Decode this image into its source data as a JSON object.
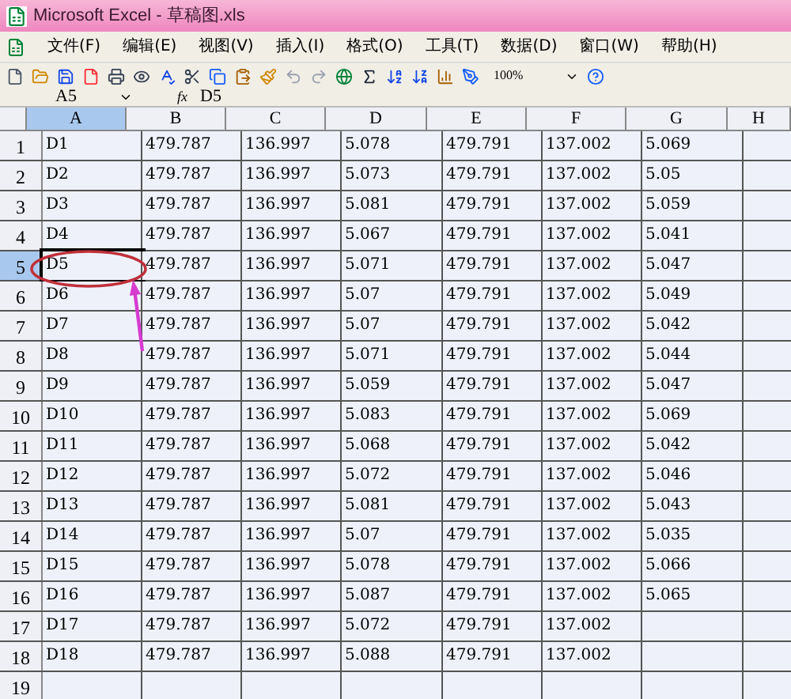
{
  "window": {
    "title": "Microsoft Excel - 草稿图.xls"
  },
  "menu": [
    "文件(F)",
    "编辑(E)",
    "视图(V)",
    "插入(I)",
    "格式(O)",
    "工具(T)",
    "数据(D)",
    "窗口(W)",
    "帮助(H)"
  ],
  "toolbar": {
    "zoom": "100%"
  },
  "formula_bar": {
    "name_box": "A5",
    "fx": "fx",
    "value": "D5"
  },
  "columns": [
    {
      "label": "A",
      "selected": true
    },
    {
      "label": "B",
      "selected": false
    },
    {
      "label": "C",
      "selected": false
    },
    {
      "label": "D",
      "selected": false
    },
    {
      "label": "E",
      "selected": false
    },
    {
      "label": "F",
      "selected": false
    },
    {
      "label": "G",
      "selected": false
    },
    {
      "label": "H",
      "selected": false
    }
  ],
  "rows": [
    {
      "number": "1",
      "selected": false,
      "cells": [
        "D1",
        "479.787",
        "136.997",
        "5.078",
        "479.791",
        "137.002",
        "5.069"
      ]
    },
    {
      "number": "2",
      "selected": false,
      "cells": [
        "D2",
        "479.787",
        "136.997",
        "5.073",
        "479.791",
        "137.002",
        "5.05"
      ]
    },
    {
      "number": "3",
      "selected": false,
      "cells": [
        "D3",
        "479.787",
        "136.997",
        "5.081",
        "479.791",
        "137.002",
        "5.059"
      ]
    },
    {
      "number": "4",
      "selected": false,
      "cells": [
        "D4",
        "479.787",
        "136.997",
        "5.067",
        "479.791",
        "137.002",
        "5.041"
      ]
    },
    {
      "number": "5",
      "selected": true,
      "cells": [
        "D5",
        "479.787",
        "136.997",
        "5.071",
        "479.791",
        "137.002",
        "5.047"
      ]
    },
    {
      "number": "6",
      "selected": false,
      "cells": [
        "D6",
        "479.787",
        "136.997",
        "5.07",
        "479.791",
        "137.002",
        "5.049"
      ]
    },
    {
      "number": "7",
      "selected": false,
      "cells": [
        "D7",
        "479.787",
        "136.997",
        "5.07",
        "479.791",
        "137.002",
        "5.042"
      ]
    },
    {
      "number": "8",
      "selected": false,
      "cells": [
        "D8",
        "479.787",
        "136.997",
        "5.071",
        "479.791",
        "137.002",
        "5.044"
      ]
    },
    {
      "number": "9",
      "selected": false,
      "cells": [
        "D9",
        "479.787",
        "136.997",
        "5.059",
        "479.791",
        "137.002",
        "5.047"
      ]
    },
    {
      "number": "10",
      "selected": false,
      "cells": [
        "D10",
        "479.787",
        "136.997",
        "5.083",
        "479.791",
        "137.002",
        "5.069"
      ]
    },
    {
      "number": "11",
      "selected": false,
      "cells": [
        "D11",
        "479.787",
        "136.997",
        "5.068",
        "479.791",
        "137.002",
        "5.042"
      ]
    },
    {
      "number": "12",
      "selected": false,
      "cells": [
        "D12",
        "479.787",
        "136.997",
        "5.072",
        "479.791",
        "137.002",
        "5.046"
      ]
    },
    {
      "number": "13",
      "selected": false,
      "cells": [
        "D13",
        "479.787",
        "136.997",
        "5.081",
        "479.791",
        "137.002",
        "5.043"
      ]
    },
    {
      "number": "14",
      "selected": false,
      "cells": [
        "D14",
        "479.787",
        "136.997",
        "5.07",
        "479.791",
        "137.002",
        "5.035"
      ]
    },
    {
      "number": "15",
      "selected": false,
      "cells": [
        "D15",
        "479.787",
        "136.997",
        "5.078",
        "479.791",
        "137.002",
        "5.066"
      ]
    },
    {
      "number": "16",
      "selected": false,
      "cells": [
        "D16",
        "479.787",
        "136.997",
        "5.087",
        "479.791",
        "137.002",
        "5.065"
      ]
    },
    {
      "number": "17",
      "selected": false,
      "cells": [
        "D17",
        "479.787",
        "136.997",
        "5.072",
        "479.791",
        "137.002"
      ]
    },
    {
      "number": "18",
      "selected": false,
      "cells": [
        "D18",
        "479.787",
        "136.997",
        "5.088",
        "479.791",
        "137.002"
      ]
    },
    {
      "number": "19",
      "selected": false,
      "cells": []
    }
  ]
}
